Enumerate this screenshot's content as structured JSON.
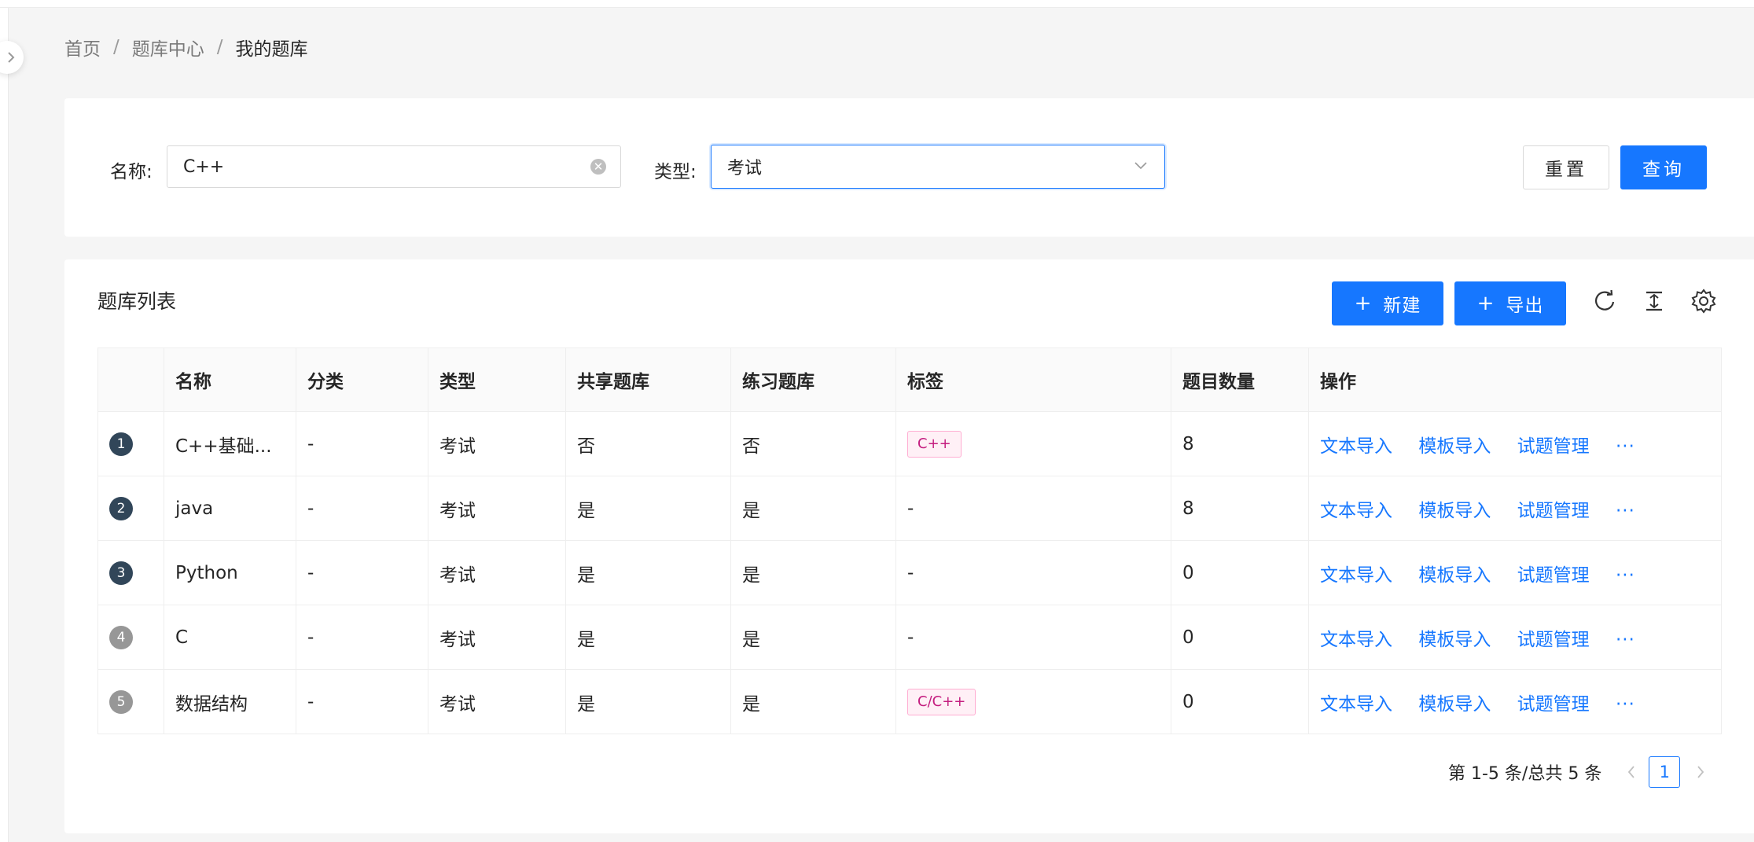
{
  "breadcrumb": {
    "home": "首页",
    "center": "题库中心",
    "current": "我的题库",
    "separator": "/"
  },
  "search": {
    "name_label": "名称:",
    "name_value": "C++",
    "type_label": "类型:",
    "type_value": "考试",
    "reset_label": "重置",
    "query_label": "查询"
  },
  "list": {
    "title": "题库列表",
    "new_label": "新建",
    "export_label": "导出",
    "columns": [
      "名称",
      "分类",
      "类型",
      "共享题库",
      "练习题库",
      "标签",
      "题目数量",
      "操作"
    ],
    "rows": [
      {
        "index": "1",
        "name": "C++基础...",
        "category": "-",
        "type": "考试",
        "shared": "否",
        "practice": "否",
        "tag": "C++",
        "count": "8"
      },
      {
        "index": "2",
        "name": "java",
        "category": "-",
        "type": "考试",
        "shared": "是",
        "practice": "是",
        "tag": "-",
        "count": "8"
      },
      {
        "index": "3",
        "name": "Python",
        "category": "-",
        "type": "考试",
        "shared": "是",
        "practice": "是",
        "tag": "-",
        "count": "0"
      },
      {
        "index": "4",
        "name": "C",
        "category": "-",
        "type": "考试",
        "shared": "是",
        "practice": "是",
        "tag": "-",
        "count": "0"
      },
      {
        "index": "5",
        "name": "数据结构",
        "category": "-",
        "type": "考试",
        "shared": "是",
        "practice": "是",
        "tag": "C/C++",
        "count": "0"
      }
    ],
    "actions": {
      "text_import": "文本导入",
      "template_import": "模板导入",
      "question_manage": "试题管理",
      "more": "···"
    }
  },
  "pagination": {
    "summary": "第 1-5 条/总共 5 条",
    "current_page": "1"
  },
  "colors": {
    "primary": "#1677ff",
    "tag_pink": "#c41d7f",
    "index_dark": "#314659",
    "index_grey": "#979797"
  },
  "icons": [
    "chevron-right-icon",
    "clear-icon",
    "chevron-down-icon",
    "plus-icon",
    "reload-icon",
    "column-height-icon",
    "setting-icon",
    "left-arrow-icon",
    "right-arrow-icon"
  ]
}
